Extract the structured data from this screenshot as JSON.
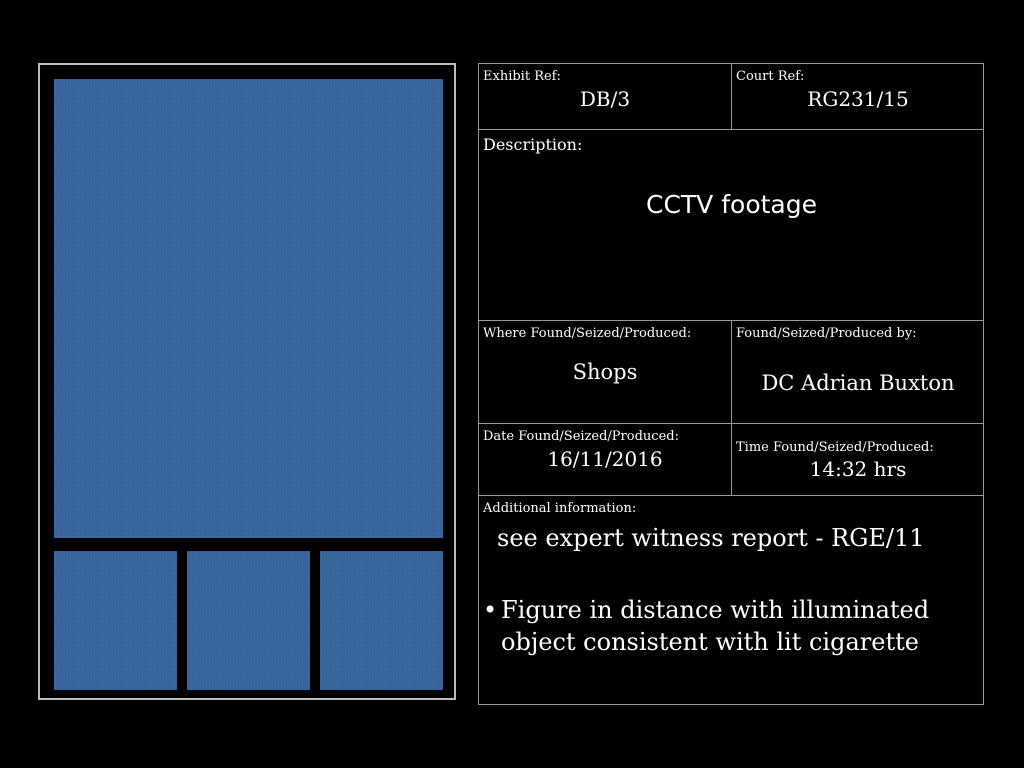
{
  "exhibit_ref": {
    "label": "Exhibit Ref:",
    "value": "DB/3"
  },
  "court_ref": {
    "label": "Court Ref:",
    "value": "RG231/15"
  },
  "description": {
    "label": "Description:",
    "value": "CCTV footage"
  },
  "where_found": {
    "label": "Where Found/Seized/Produced:",
    "value": "Shops"
  },
  "found_by": {
    "label": "Found/Seized/Produced by:",
    "value": "DC Adrian Buxton"
  },
  "date_found": {
    "label": "Date Found/Seized/Produced:",
    "value": "16/11/2016"
  },
  "time_found": {
    "label": "Time Found/Seized/Produced:",
    "value": "14:32 hrs"
  },
  "additional_info": {
    "label": "Additional information:",
    "text": "see expert witness report - RGE/11",
    "bullets": [
      "Figure in distance with illuminated object consistent with lit cigarette"
    ]
  },
  "colors": {
    "background": "#000000",
    "photo_placeholder": "#35649c",
    "border": "#9a9a9a",
    "text": "#ffffff"
  }
}
